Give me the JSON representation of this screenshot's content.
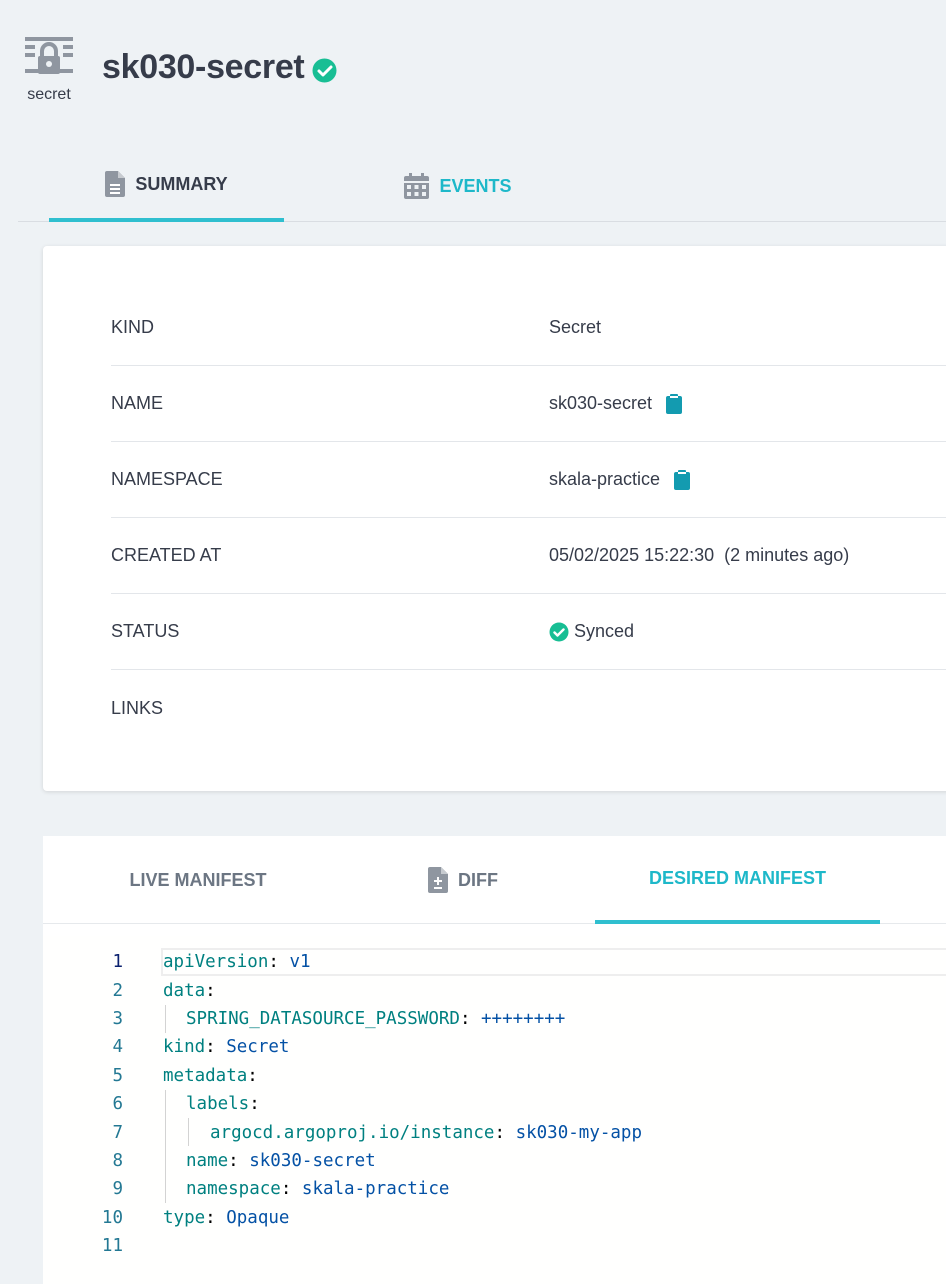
{
  "header": {
    "kind_label": "secret",
    "title": "sk030-secret"
  },
  "tabs": [
    {
      "label": "SUMMARY",
      "icon": "file-text-icon",
      "active": true
    },
    {
      "label": "EVENTS",
      "icon": "calendar-icon",
      "active": false
    }
  ],
  "summary": {
    "rows": [
      {
        "key": "KIND",
        "value": "Secret"
      },
      {
        "key": "NAME",
        "value": "sk030-secret",
        "copy": true
      },
      {
        "key": "NAMESPACE",
        "value": "skala-practice",
        "copy": true
      },
      {
        "key": "CREATED AT",
        "value": "05/02/2025 15:22:30  (2 minutes ago)"
      },
      {
        "key": "STATUS",
        "value": "Synced",
        "status_icon": "check-circle-icon"
      },
      {
        "key": "LINKS",
        "value": ""
      }
    ]
  },
  "manifest_tabs": [
    {
      "label": "LIVE MANIFEST",
      "active": false
    },
    {
      "label": "DIFF",
      "icon": "file-diff-icon",
      "active": false
    },
    {
      "label": "DESIRED MANIFEST",
      "active": true
    }
  ],
  "editor": {
    "lines": [
      {
        "n": "1",
        "indent": 0,
        "key": "apiVersion",
        "value": "v1"
      },
      {
        "n": "2",
        "indent": 0,
        "key": "data",
        "value": ""
      },
      {
        "n": "3",
        "indent": 1,
        "key": "SPRING_DATASOURCE_PASSWORD",
        "value": "++++++++"
      },
      {
        "n": "4",
        "indent": 0,
        "key": "kind",
        "value": "Secret"
      },
      {
        "n": "5",
        "indent": 0,
        "key": "metadata",
        "value": ""
      },
      {
        "n": "6",
        "indent": 1,
        "key": "labels",
        "value": ""
      },
      {
        "n": "7",
        "indent": 2,
        "key": "argocd.argoproj.io/instance",
        "value": "sk030-my-app"
      },
      {
        "n": "8",
        "indent": 1,
        "key": "name",
        "value": "sk030-secret"
      },
      {
        "n": "9",
        "indent": 1,
        "key": "namespace",
        "value": "skala-practice"
      },
      {
        "n": "10",
        "indent": 0,
        "key": "type",
        "value": "Opaque"
      },
      {
        "n": "11",
        "indent": 0,
        "key": "",
        "value": ""
      }
    ]
  },
  "colors": {
    "accent": "#1eb8c9",
    "success": "#18be94",
    "background": "#eef2f5"
  }
}
